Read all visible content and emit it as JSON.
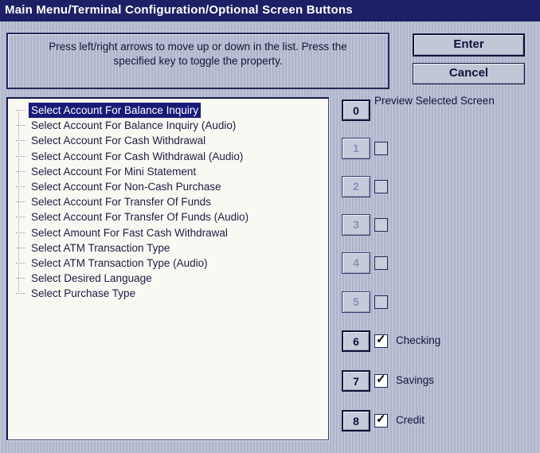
{
  "window": {
    "title": "Main Menu/Terminal Configuration/Optional Screen Buttons"
  },
  "instructions": {
    "line1": "Press left/right arrows to move up or down in the list.  Press the",
    "line2": "specified key to toggle the property."
  },
  "actions": {
    "enter_label": "Enter",
    "cancel_label": "Cancel"
  },
  "screen_list": {
    "items": [
      {
        "label": "Select Account For Balance Inquiry",
        "selected": true
      },
      {
        "label": "Select Account For Balance Inquiry (Audio)",
        "selected": false
      },
      {
        "label": "Select Account For Cash Withdrawal",
        "selected": false
      },
      {
        "label": "Select Account For Cash Withdrawal (Audio)",
        "selected": false
      },
      {
        "label": "Select Account For Mini Statement",
        "selected": false
      },
      {
        "label": "Select Account For Non-Cash Purchase",
        "selected": false
      },
      {
        "label": "Select Account For Transfer Of Funds",
        "selected": false
      },
      {
        "label": "Select Account For Transfer Of Funds (Audio)",
        "selected": false
      },
      {
        "label": "Select Amount For Fast Cash Withdrawal",
        "selected": false
      },
      {
        "label": "Select ATM Transaction Type",
        "selected": false
      },
      {
        "label": "Select ATM Transaction Type (Audio)",
        "selected": false
      },
      {
        "label": "Select Desired Language",
        "selected": false
      },
      {
        "label": "Select Purchase Type",
        "selected": false
      }
    ]
  },
  "preview_label": "Preview Selected Screen",
  "key_rows": [
    {
      "key": "0",
      "enabled": true,
      "has_checkbox": false,
      "checked": false,
      "label": ""
    },
    {
      "key": "1",
      "enabled": false,
      "has_checkbox": true,
      "checked": false,
      "label": ""
    },
    {
      "key": "2",
      "enabled": false,
      "has_checkbox": true,
      "checked": false,
      "label": ""
    },
    {
      "key": "3",
      "enabled": false,
      "has_checkbox": true,
      "checked": false,
      "label": ""
    },
    {
      "key": "4",
      "enabled": false,
      "has_checkbox": true,
      "checked": false,
      "label": ""
    },
    {
      "key": "5",
      "enabled": false,
      "has_checkbox": true,
      "checked": false,
      "label": ""
    },
    {
      "key": "6",
      "enabled": true,
      "has_checkbox": true,
      "checked": true,
      "label": "Checking"
    },
    {
      "key": "7",
      "enabled": true,
      "has_checkbox": true,
      "checked": true,
      "label": "Savings"
    },
    {
      "key": "8",
      "enabled": true,
      "has_checkbox": true,
      "checked": true,
      "label": "Credit"
    }
  ],
  "icons": {
    "checkmark": "✓"
  },
  "colors": {
    "titlebar_bg": "#1e2066",
    "titlebar_text": "#ffffff",
    "dialog_bg": "#b7bdd1",
    "selection_bg": "#191a78",
    "selection_text": "#ffffff",
    "listbox_bg": "#faf8f3",
    "text": "#14153a",
    "disabled_text": "#8791b4"
  }
}
